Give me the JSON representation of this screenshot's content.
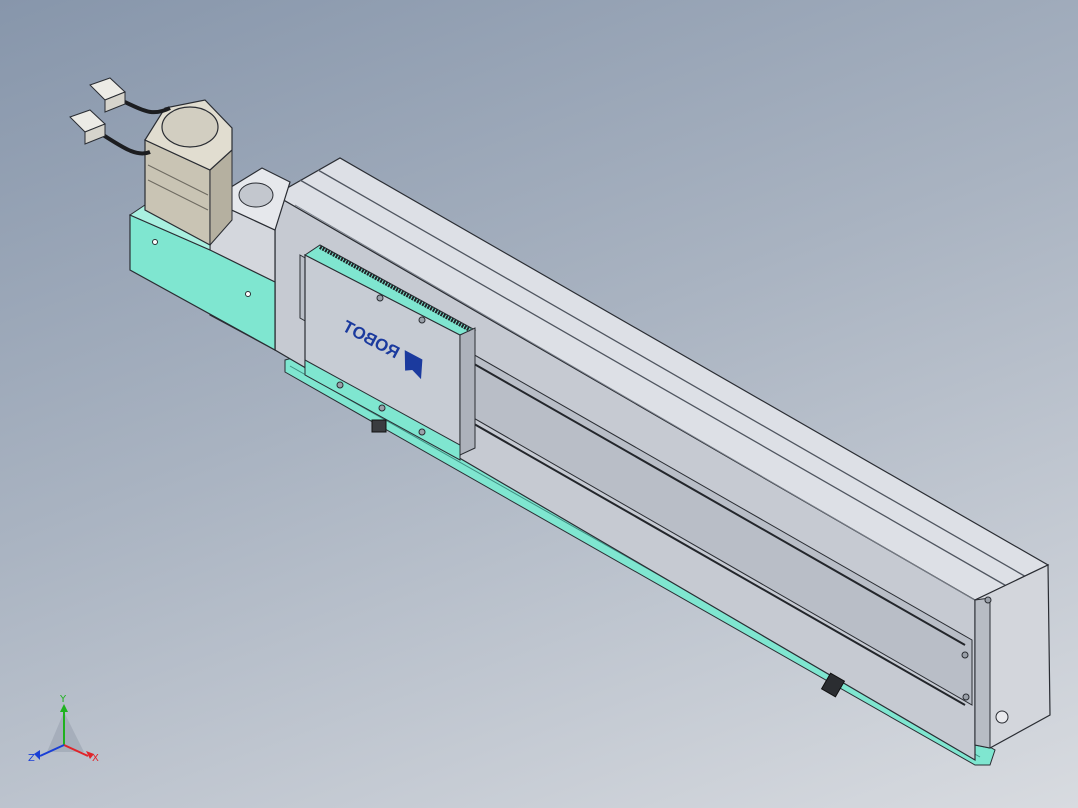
{
  "viewport": {
    "background_top": "#8796ab",
    "background_bottom": "#d8dbe0"
  },
  "model": {
    "logo_text": "ROBOT",
    "colors": {
      "body": "#c8ccd4",
      "body_top": "#dfe2e8",
      "accent": "#7fe6d0",
      "motor": "#c9c4b4",
      "outline": "#2a2d33"
    }
  },
  "triad": {
    "x_label": "X",
    "y_label": "Y",
    "z_label": "Z",
    "x_color": "#e0242a",
    "y_color": "#1fb21f",
    "z_color": "#1a3fd6"
  }
}
